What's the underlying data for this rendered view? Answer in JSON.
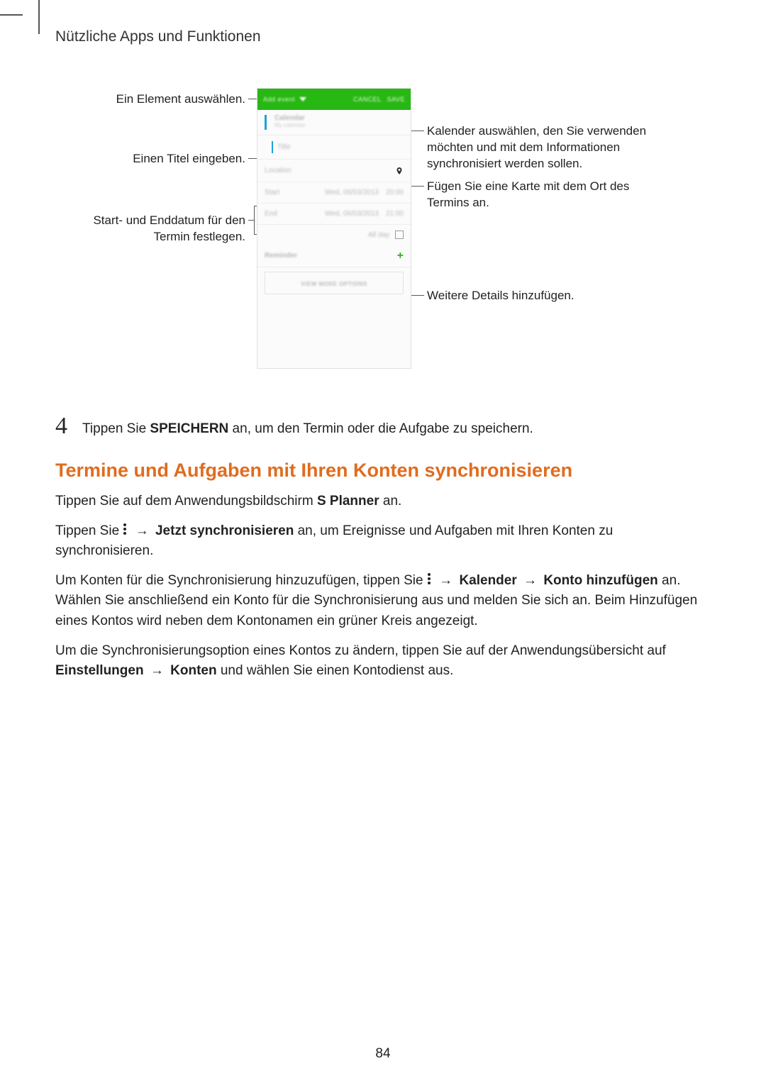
{
  "chapter": "Nützliche Apps und Funktionen",
  "callouts": {
    "select_element": "Ein Element auswählen.",
    "enter_title": "Einen Titel eingeben.",
    "set_dates": "Start- und Enddatum für den Termin festlegen.",
    "select_calendar": "Kalender auswählen, den Sie verwenden möchten und mit dem Informationen synchronisiert werden sollen.",
    "add_map": "Fügen Sie eine Karte mit dem Ort des Termins an.",
    "more_details": "Weitere Details hinzufügen."
  },
  "phone": {
    "header_left": "Add event",
    "header_cancel": "CANCEL",
    "header_save": "SAVE",
    "calendar_label": "Calendar",
    "calendar_sub": "My calendar",
    "title_placeholder": "Title",
    "location_placeholder": "Location",
    "start_label": "Start",
    "start_date": "Wed, 06/03/2013",
    "start_time": "20:00",
    "end_label": "End",
    "end_date": "Wed, 06/03/2013",
    "end_time": "21:00",
    "all_day": "All day",
    "reminder": "Reminder",
    "more_options": "VIEW MORE OPTIONS"
  },
  "step4": {
    "num": "4",
    "pre": "Tippen Sie ",
    "bold": "SPEICHERN",
    "post": " an, um den Termin oder die Aufgabe zu speichern."
  },
  "section_heading": "Termine und Aufgaben mit Ihren Konten synchronisieren",
  "p1": {
    "pre": "Tippen Sie auf dem Anwendungsbildschirm ",
    "bold": "S Planner",
    "post": " an."
  },
  "p2": {
    "pre": "Tippen Sie ",
    "arrow": "→",
    "bold": "Jetzt synchronisieren",
    "post": " an, um Ereignisse und Aufgaben mit Ihren Konten zu synchronisieren."
  },
  "p3": {
    "pre": "Um Konten für die Synchronisierung hinzuzufügen, tippen Sie ",
    "arrow1": "→",
    "bold1": "Kalender",
    "arrow2": "→",
    "bold2": "Konto hinzufügen",
    "post": " an. Wählen Sie anschließend ein Konto für die Synchronisierung aus und melden Sie sich an. Beim Hinzufügen eines Kontos wird neben dem Kontonamen ein grüner Kreis angezeigt."
  },
  "p4": {
    "pre": "Um die Synchronisierungsoption eines Kontos zu ändern, tippen Sie auf der Anwendungsübersicht auf ",
    "bold1": "Einstellungen",
    "arrow": "→",
    "bold2": "Konten",
    "post": " und wählen Sie einen Kontodienst aus."
  },
  "page_number": "84"
}
